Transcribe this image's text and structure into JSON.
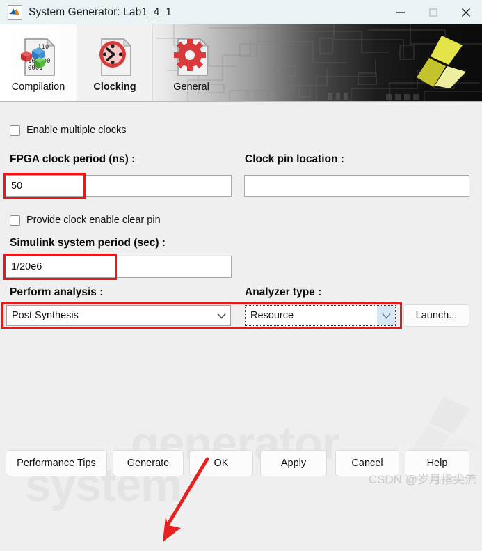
{
  "window": {
    "title": "System Generator: Lab1_4_1",
    "icon": "matlab-icon",
    "controls": {
      "minimize": "minimize-icon",
      "maximize": "maximize-icon",
      "close": "close-icon"
    }
  },
  "tabs": [
    {
      "label": "Compilation",
      "icon": "compilation-icon",
      "selected": false
    },
    {
      "label": "Clocking",
      "icon": "clock-icon",
      "selected": true
    },
    {
      "label": "General",
      "icon": "gear-icon",
      "selected": false
    }
  ],
  "form": {
    "enable_multiple_clocks": {
      "label": "Enable multiple clocks",
      "checked": false
    },
    "fpga_clock_period": {
      "label": "FPGA clock period (ns) :",
      "value": "50"
    },
    "clock_pin_location": {
      "label": "Clock pin location :",
      "value": ""
    },
    "provide_clock_enable_clear_pin": {
      "label": "Provide clock enable clear pin",
      "checked": false
    },
    "simulink_system_period": {
      "label": "Simulink system period (sec) :",
      "value": "1/20e6"
    },
    "perform_analysis": {
      "label": "Perform analysis :",
      "value": "Post Synthesis"
    },
    "analyzer_type": {
      "label": "Analyzer type :",
      "value": "Resource"
    },
    "launch_button": "Launch..."
  },
  "footer": {
    "buttons": [
      "Performance Tips",
      "Generate",
      "OK",
      "Apply",
      "Cancel",
      "Help"
    ]
  },
  "watermarks": {
    "background_line1": "generator",
    "background_line2": "system",
    "credit": "CSDN @岁月指尖流"
  },
  "annotations": {
    "highlight_color": "#e8171a",
    "arrow_target": "generate-button"
  }
}
